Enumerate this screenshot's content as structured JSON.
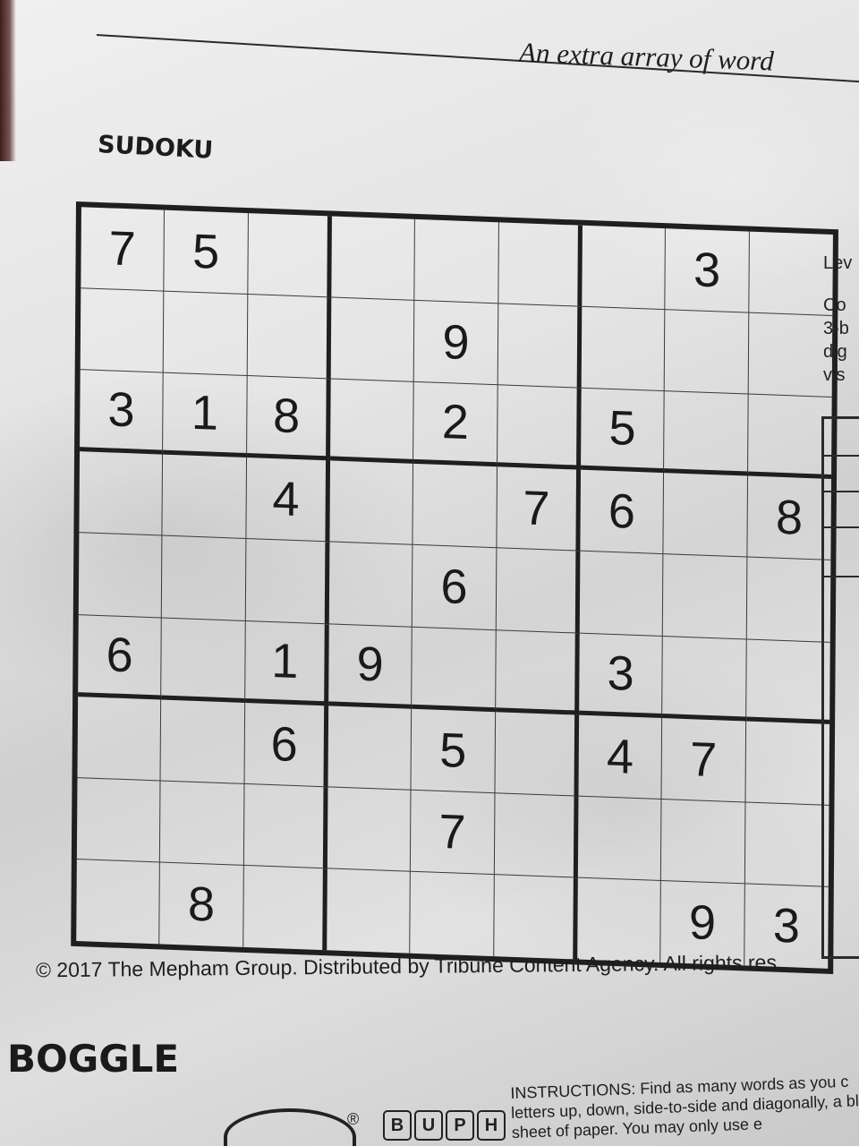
{
  "header": {
    "tagline": "An extra array of word",
    "section_title": "SUDOKU"
  },
  "sudoku": {
    "grid": [
      [
        "7",
        "5",
        "",
        "",
        "",
        "",
        "",
        "3",
        ""
      ],
      [
        "",
        "",
        "",
        "",
        "9",
        "",
        "",
        "",
        ""
      ],
      [
        "3",
        "1",
        "8",
        "",
        "2",
        "",
        "5",
        "",
        ""
      ],
      [
        "",
        "",
        "4",
        "",
        "",
        "7",
        "6",
        "",
        "8"
      ],
      [
        "",
        "",
        "",
        "",
        "6",
        "",
        "",
        "",
        ""
      ],
      [
        "6",
        "",
        "1",
        "9",
        "",
        "",
        "3",
        "",
        ""
      ],
      [
        "",
        "",
        "6",
        "",
        "5",
        "",
        "4",
        "7",
        ""
      ],
      [
        "",
        "",
        "",
        "",
        "7",
        "",
        "",
        "",
        ""
      ],
      [
        "",
        "8",
        "",
        "",
        "",
        "",
        "",
        "9",
        "3"
      ]
    ]
  },
  "side_panel": {
    "level_label": "Lev",
    "lines": [
      "Co",
      "3-b",
      "dig",
      "vis"
    ]
  },
  "copyright": "© 2017 The Mepham Group. Distributed by Tribune Content Agency. All rights res",
  "boggle": {
    "title": "BOGGLE",
    "letters": [
      "B",
      "U",
      "P",
      "H"
    ],
    "registered": "®",
    "instructions": "INSTRUCTIONS: Find as many words as you c letters up, down, side-to-side and diagonally, a blank sheet of paper. You may only use e"
  }
}
